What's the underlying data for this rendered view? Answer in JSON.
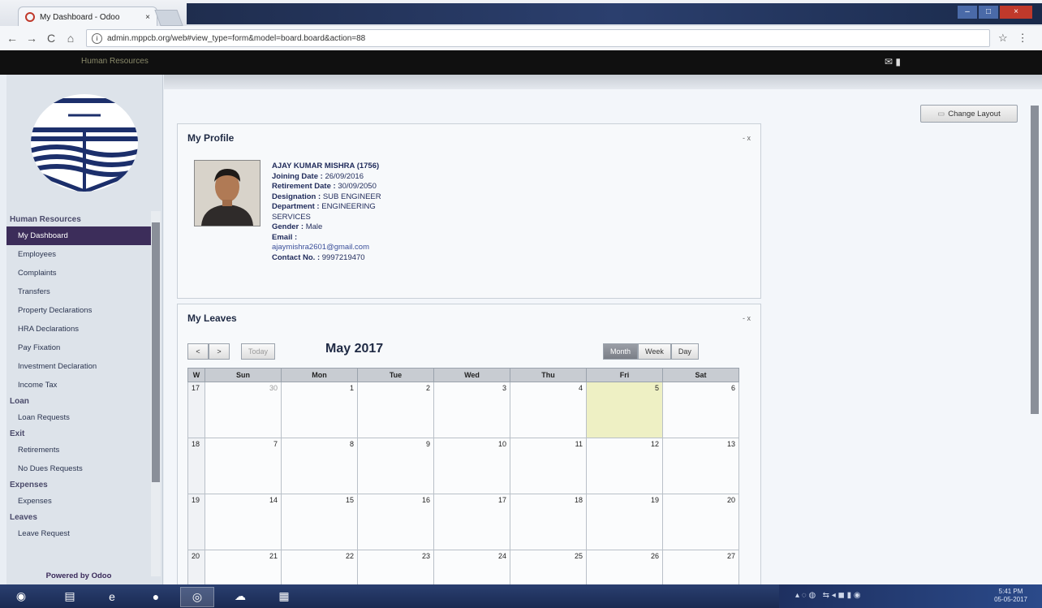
{
  "browser": {
    "tab_title": "My Dashboard - Odoo",
    "tab_close": "×",
    "url": "admin.mppcb.org/web#view_type=form&model=board.board&action=88",
    "back": "←",
    "forward": "→",
    "reload": "C",
    "home": "⌂",
    "star": "☆",
    "menu": "⋮",
    "info": "i"
  },
  "appbar": {
    "module": "Human Resources"
  },
  "sidebar": {
    "sections": [
      {
        "label": "Human Resources",
        "items": [
          "My Dashboard",
          "Employees",
          "Complaints",
          "Transfers",
          "Property Declarations",
          "HRA Declarations",
          "Pay Fixation",
          "Investment Declaration",
          "Income Tax"
        ]
      },
      {
        "label": "Loan",
        "items": [
          "Loan Requests"
        ]
      },
      {
        "label": "Exit",
        "items": [
          "Retirements",
          "No Dues Requests"
        ]
      },
      {
        "label": "Expenses",
        "items": [
          "Expenses"
        ]
      },
      {
        "label": "Leaves",
        "items": [
          "Leave Request"
        ]
      }
    ],
    "active_item": "My Dashboard",
    "powered_by": "Powered by Odoo"
  },
  "main": {
    "change_layout": "Change Layout",
    "profile": {
      "title": "My Profile",
      "controls": "- x",
      "name": "AJAY KUMAR MISHRA (1756)",
      "joining_label": "Joining Date :",
      "joining": "26/09/2016",
      "retirement_label": "Retirement Date :",
      "retirement": "30/09/2050",
      "designation_label": "Designation :",
      "designation": "SUB ENGINEER",
      "department_label": "Department :",
      "department": "ENGINEERING SERVICES",
      "gender_label": "Gender :",
      "gender": "Male",
      "email_label": "Email :",
      "email": "ajaymishra2601@gmail.com",
      "contact_label": "Contact No. :",
      "contact": "9997219470"
    },
    "leaves": {
      "title": "My Leaves",
      "controls": "- x",
      "prev": "<",
      "next": ">",
      "today": "Today",
      "month_label": "May 2017",
      "views": [
        "Month",
        "Week",
        "Day"
      ],
      "active_view": "Month",
      "headers": [
        "W",
        "Sun",
        "Mon",
        "Tue",
        "Wed",
        "Thu",
        "Fri",
        "Sat"
      ],
      "weeks": [
        {
          "w": "17",
          "days": [
            "30",
            "1",
            "2",
            "3",
            "4",
            "5",
            "6"
          ]
        },
        {
          "w": "18",
          "days": [
            "7",
            "8",
            "9",
            "10",
            "11",
            "12",
            "13"
          ]
        },
        {
          "w": "19",
          "days": [
            "14",
            "15",
            "16",
            "17",
            "18",
            "19",
            "20"
          ]
        },
        {
          "w": "20",
          "days": [
            "21",
            "22",
            "23",
            "24",
            "25",
            "26",
            "27"
          ]
        }
      ]
    }
  },
  "taskbar": {
    "clock_time": "5:41 PM",
    "clock_date": "05-05-2017"
  }
}
